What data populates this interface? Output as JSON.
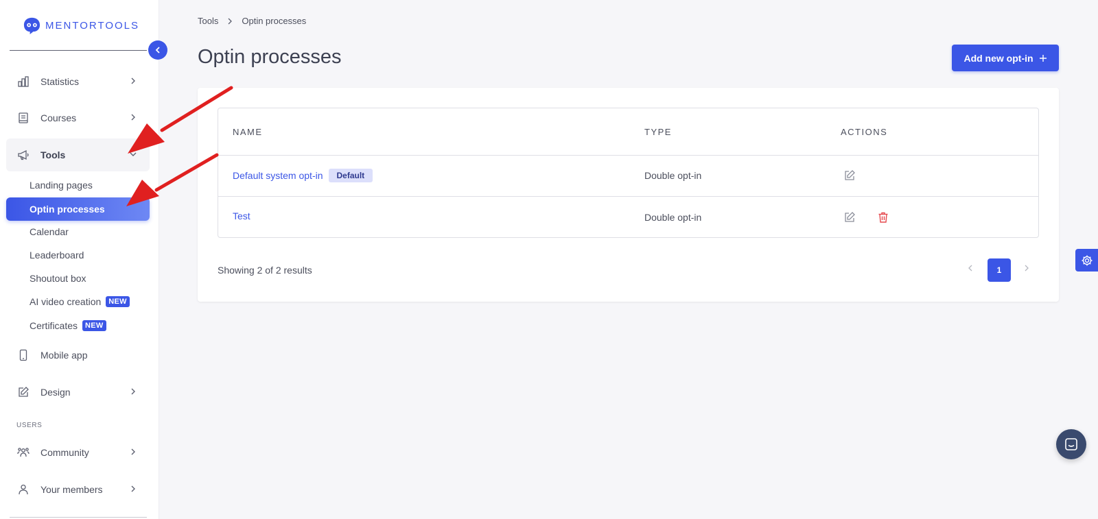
{
  "brand": {
    "name": "MENTORTOOLS",
    "color": "#3b56e6"
  },
  "sidebar": {
    "items": [
      {
        "label": "Statistics",
        "icon": "bar-chart-icon"
      },
      {
        "label": "Courses",
        "icon": "book-icon"
      },
      {
        "label": "Tools",
        "icon": "megaphone-icon",
        "open": true
      },
      {
        "label": "Mobile app",
        "icon": "phone-icon"
      },
      {
        "label": "Design",
        "icon": "pencil-icon"
      },
      {
        "label": "Community",
        "icon": "users-icon"
      },
      {
        "label": "Your members",
        "icon": "user-icon"
      }
    ],
    "tools_sub": [
      {
        "label": "Landing pages"
      },
      {
        "label": "Optin processes",
        "active": true
      },
      {
        "label": "Calendar"
      },
      {
        "label": "Leaderboard"
      },
      {
        "label": "Shoutout box"
      },
      {
        "label": "AI video creation",
        "badge": "NEW"
      },
      {
        "label": "Certificates",
        "badge": "NEW"
      }
    ],
    "section_users": "USERS"
  },
  "breadcrumb": {
    "root": "Tools",
    "current": "Optin processes"
  },
  "page": {
    "title": "Optin processes",
    "add_button": "Add new opt-in"
  },
  "table": {
    "headers": {
      "name": "NAME",
      "type": "TYPE",
      "actions": "ACTIONS"
    },
    "rows": [
      {
        "name": "Default system opt-in",
        "badge": "Default",
        "type": "Double opt-in",
        "actions": [
          "edit-icon"
        ]
      },
      {
        "name": "Test",
        "type": "Double opt-in",
        "actions": [
          "edit-icon",
          "trash-icon"
        ]
      }
    ]
  },
  "pagination": {
    "summary": "Showing 2 of 2 results",
    "current_page": "1"
  },
  "colors": {
    "accent": "#3b56e6",
    "danger": "#e5484d",
    "annotation_arrow": "#e02020"
  }
}
